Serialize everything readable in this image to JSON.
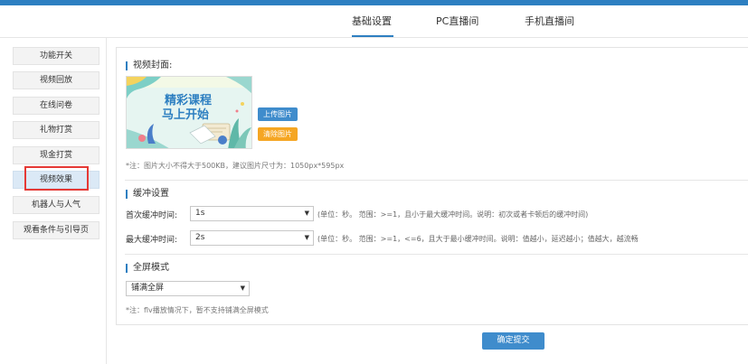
{
  "tabs": [
    {
      "label": "基础设置",
      "active": true
    },
    {
      "label": "PC直播间",
      "active": false
    },
    {
      "label": "手机直播间",
      "active": false
    }
  ],
  "sidebar": {
    "items": [
      {
        "label": "功能开关"
      },
      {
        "label": "视频回放"
      },
      {
        "label": "在线问卷"
      },
      {
        "label": "礼物打赏"
      },
      {
        "label": "现金打赏"
      },
      {
        "label": "视频效果",
        "active": true
      },
      {
        "label": "机器人与人气"
      },
      {
        "label": "观看条件与引导页"
      }
    ]
  },
  "cover": {
    "title": "视频封面:",
    "image_line1": "精彩课程",
    "image_line2": "马上开始",
    "upload_label": "上传图片",
    "clear_label": "清除图片",
    "note": "*注：图片大小不得大于500KB，建议图片尺寸为：1050px*595px"
  },
  "buffer": {
    "title": "缓冲设置",
    "first_label": "首次缓冲时间:",
    "first_value": "1s",
    "first_hint": "(单位：秒。 范围：>=1，且小于最大缓冲时间。说明：初次或者卡顿后的缓冲时间)",
    "max_label": "最大缓冲时间:",
    "max_value": "2s",
    "max_hint": "(单位：秒。 范围：>=1，<=6，且大于最小缓冲时间。说明：值越小，延迟越小；值越大，越流畅"
  },
  "fullscreen": {
    "title": "全屏模式",
    "value": "铺满全屏",
    "note": "*注：flv播放情况下，暂不支持铺满全屏模式"
  },
  "confirm_label": "确定提交",
  "colors": {
    "accent": "#2d7fc1",
    "button_blue": "#3f8ccc",
    "button_orange": "#f5a623",
    "highlight_red": "#e53935"
  }
}
